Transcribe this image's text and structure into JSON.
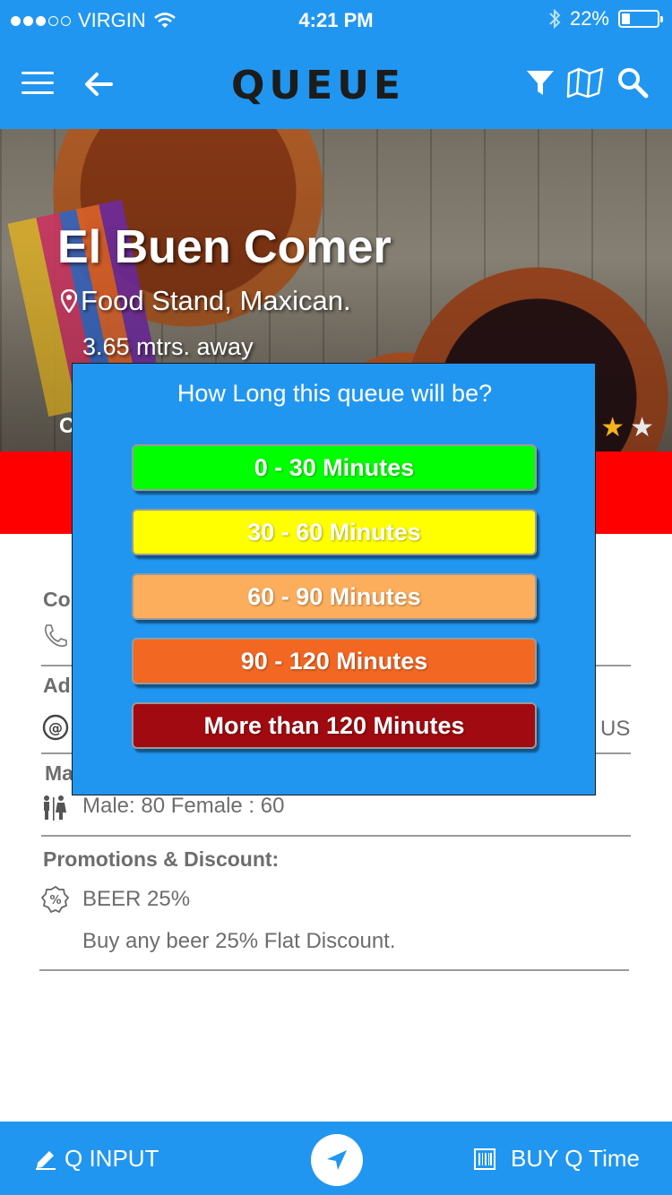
{
  "status_bar": {
    "carrier": "VIRGIN",
    "time": "4:21 PM",
    "battery": "22%",
    "battery_level": 0.22,
    "signal_bars": 3,
    "signal_max": 5,
    "icons": [
      "wifi-icon",
      "bluetooth-icon",
      "battery-icon"
    ]
  },
  "header": {
    "brand": "QUEUE",
    "icons": [
      "menu-icon",
      "back-arrow-icon",
      "filter-icon",
      "map-icon",
      "search-icon"
    ]
  },
  "venue": {
    "name": "El Buen Comer",
    "category": "Food Stand, Maxican.",
    "distance": "3.65 mtrs. away",
    "partial_label": "C",
    "rating_stars_visible": [
      "star-filled",
      "star-empty"
    ]
  },
  "details": {
    "contact_label": "Co",
    "address_label": "Ad",
    "address_tail": "US",
    "ma_label": "Ma",
    "capacity": "Male: 80 Female : 60",
    "promotions_label": "Promotions & Discount:",
    "promo_title": "BEER 25%",
    "promo_description": "Buy any beer 25% Flat Discount."
  },
  "modal": {
    "title": "How Long this queue will be?",
    "options": [
      {
        "label": "0 - 30 Minutes",
        "color": "#00ff00"
      },
      {
        "label": "30 - 60 Minutes",
        "color": "#ffff00"
      },
      {
        "label": "60 - 90 Minutes",
        "color": "#fcae5c"
      },
      {
        "label": "90 - 120 Minutes",
        "color": "#f26722"
      },
      {
        "label": "More than 120 Minutes",
        "color": "#a00a10"
      }
    ]
  },
  "bottom_bar": {
    "left_label": "Q INPUT",
    "right_label": "BUY Q Time"
  },
  "colors": {
    "primary": "#2196f0",
    "alert_band": "#ff0000",
    "star": "#f6b21b"
  }
}
